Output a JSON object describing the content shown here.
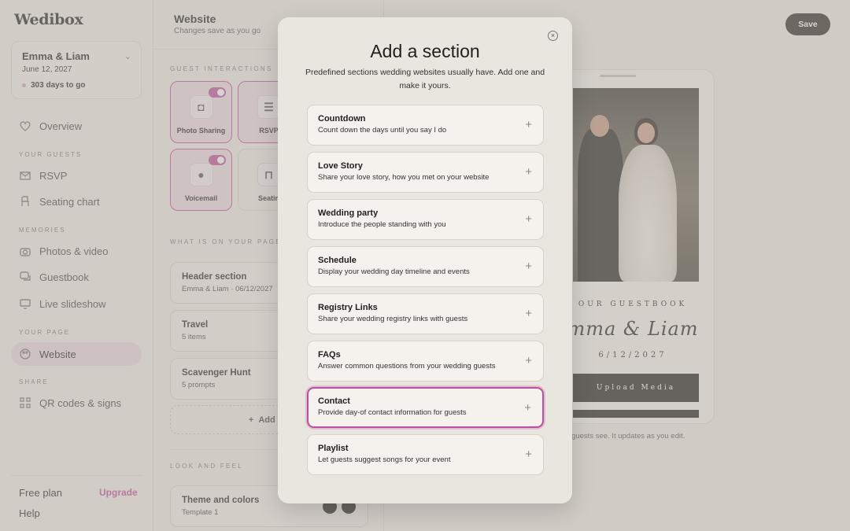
{
  "brand": {
    "logo": "Wedibox"
  },
  "event": {
    "names": "Emma & Liam",
    "date": "June 12, 2027",
    "countdown": "303 days to go"
  },
  "sidebar": {
    "overview": "Overview",
    "sections": {
      "guests": "YOUR GUESTS",
      "memories": "MEMORIES",
      "page": "YOUR PAGE",
      "share": "SHARE"
    },
    "items": {
      "rsvp": "RSVP",
      "seating": "Seating chart",
      "photos": "Photos & video",
      "guestbook": "Guestbook",
      "slideshow": "Live slideshow",
      "website": "Website",
      "qr": "QR codes & signs"
    },
    "plan": "Free plan",
    "upgrade": "Upgrade",
    "help": "Help"
  },
  "editor": {
    "title": "Website",
    "subtitle": "Changes save as you go",
    "guest_interactions": "GUEST INTERACTIONS",
    "tiles": {
      "photo_sharing": "Photo Sharing",
      "rsvp": "RSVP",
      "voicemail": "Voicemail",
      "seating": "Seatin"
    },
    "on_page": "WHAT IS ON YOUR PAGE",
    "cards": [
      {
        "title": "Header section",
        "sub": "Emma & Liam · 06/12/2027"
      },
      {
        "title": "Travel",
        "sub": "5 items"
      },
      {
        "title": "Scavenger Hunt",
        "sub": "5 prompts"
      }
    ],
    "add_section": "Add a s",
    "look_feel": "LOOK AND FEEL",
    "theme": {
      "title": "Theme and colors",
      "sub": "Template 1"
    }
  },
  "toolbar": {
    "save": "Save"
  },
  "preview": {
    "guestbook_label": "OUR GUESTBOOK",
    "names": "mma & Liam",
    "date": "6/12/2027",
    "upload": "Upload Media",
    "note": "ur guests see. It updates as you edit."
  },
  "modal": {
    "title": "Add a section",
    "description": "Predefined sections wedding websites usually have. Add one and make it yours.",
    "options": [
      {
        "title": "Countdown",
        "sub": "Count down the days until you say I do"
      },
      {
        "title": "Love Story",
        "sub": "Share your love story, how you met on your website"
      },
      {
        "title": "Wedding party",
        "sub": "Introduce the people standing with you"
      },
      {
        "title": "Schedule",
        "sub": "Display your wedding day timeline and events"
      },
      {
        "title": "Registry Links",
        "sub": "Share your wedding registry links with guests"
      },
      {
        "title": "FAQs",
        "sub": "Answer common questions from your wedding guests"
      },
      {
        "title": "Contact",
        "sub": "Provide day-of contact information for guests"
      },
      {
        "title": "Playlist",
        "sub": "Let guests suggest songs for your event"
      }
    ],
    "selected_index": 6
  },
  "colors": {
    "accent": "#c04ea0",
    "dark": "#2a2624"
  }
}
